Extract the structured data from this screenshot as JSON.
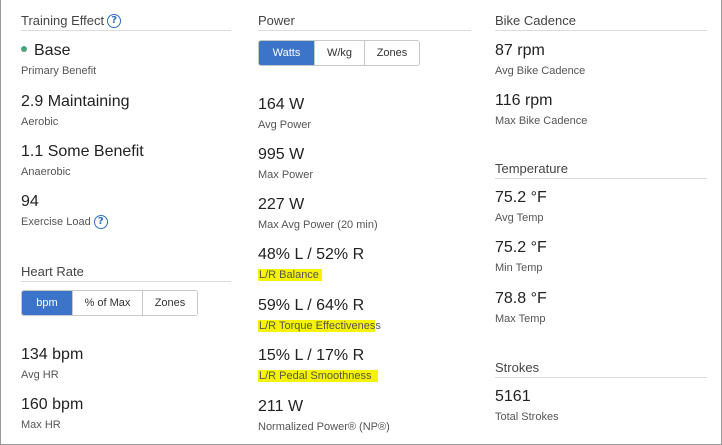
{
  "training_effect": {
    "title": "Training Effect",
    "help": "?",
    "primary": {
      "value": "Base",
      "label": "Primary Benefit"
    },
    "aerobic": {
      "value": "2.9 Maintaining",
      "label": "Aerobic"
    },
    "anaerobic": {
      "value": "1.1 Some Benefit",
      "label": "Anaerobic"
    },
    "load": {
      "value": "94",
      "label": "Exercise Load",
      "help": "?"
    },
    "dot_color": "#4aa57a"
  },
  "heart_rate": {
    "title": "Heart Rate",
    "tabs": [
      "bpm",
      "% of Max",
      "Zones"
    ],
    "active_tab": "bpm",
    "avg": {
      "value": "134 bpm",
      "label": "Avg HR"
    },
    "max": {
      "value": "160 bpm",
      "label": "Max HR"
    }
  },
  "power": {
    "title": "Power",
    "tabs": [
      "Watts",
      "W/kg",
      "Zones"
    ],
    "active_tab": "Watts",
    "avg": {
      "value": "164 W",
      "label": "Avg Power"
    },
    "max": {
      "value": "995 W",
      "label": "Max Power"
    },
    "max_avg": {
      "value": "227 W",
      "label": "Max Avg Power (20 min)"
    },
    "balance": {
      "value": "48% L / 52% R",
      "label": "L/R Balance"
    },
    "torque": {
      "value": "59% L / 64% R",
      "label_highlight": "L/R Torque Effectivenes",
      "label_rest": "s"
    },
    "smoothness": {
      "value": "15% L / 17% R",
      "label": "L/R Pedal Smoothness"
    },
    "np": {
      "value": "211 W",
      "label": "Normalized Power® (NP®)"
    }
  },
  "bike_cadence": {
    "title": "Bike Cadence",
    "avg": {
      "value": "87 rpm",
      "label": "Avg Bike Cadence"
    },
    "max": {
      "value": "116 rpm",
      "label": "Max Bike Cadence"
    }
  },
  "temperature": {
    "title": "Temperature",
    "avg": {
      "value": "75.2 °F",
      "label": "Avg Temp"
    },
    "min": {
      "value": "75.2 °F",
      "label": "Min Temp"
    },
    "max": {
      "value": "78.8 °F",
      "label": "Max Temp"
    }
  },
  "strokes": {
    "title": "Strokes",
    "total": {
      "value": "5161",
      "label": "Total Strokes"
    }
  },
  "colors": {
    "accent": "#3b74c9",
    "highlight": "#f6f300",
    "help_icon": "#2e6fbf"
  }
}
